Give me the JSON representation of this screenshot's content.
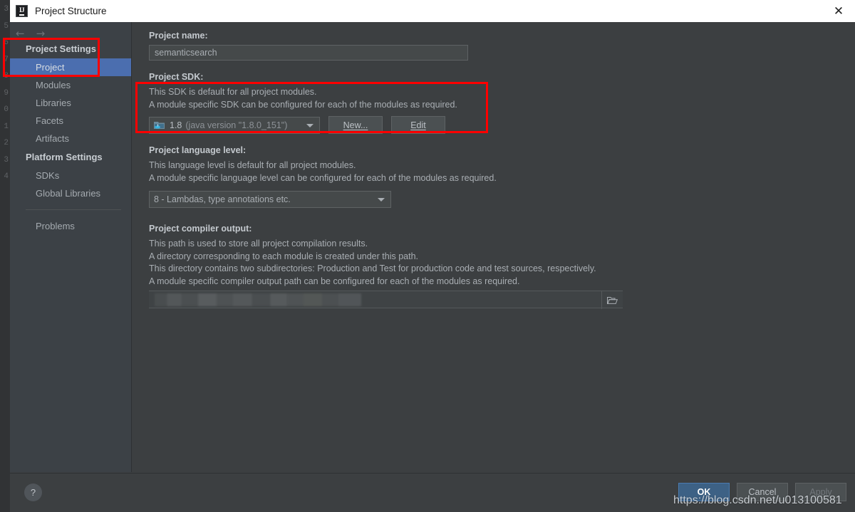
{
  "window": {
    "title": "Project Structure",
    "logo_icon": "intellij-idea-logo",
    "close_icon": "close-icon"
  },
  "editor_gutter": {
    "line_numbers": [
      "3",
      "5",
      "6",
      "7",
      "8",
      "9",
      "0",
      "1",
      "2",
      "3",
      "4"
    ]
  },
  "sidebar": {
    "back_icon": "arrow-left-icon",
    "forward_icon": "arrow-right-icon",
    "groups": [
      {
        "label": "Project Settings",
        "items": [
          {
            "label": "Project",
            "selected": true
          },
          {
            "label": "Modules",
            "selected": false
          },
          {
            "label": "Libraries",
            "selected": false
          },
          {
            "label": "Facets",
            "selected": false
          },
          {
            "label": "Artifacts",
            "selected": false
          }
        ]
      },
      {
        "label": "Platform Settings",
        "items": [
          {
            "label": "SDKs",
            "selected": false
          },
          {
            "label": "Global Libraries",
            "selected": false
          }
        ]
      }
    ],
    "problems_label": "Problems"
  },
  "main": {
    "project_name": {
      "label": "Project name:",
      "value": "semanticsearch"
    },
    "project_sdk": {
      "label": "Project SDK:",
      "description_line1": "This SDK is default for all project modules.",
      "description_line2": "A module specific SDK can be configured for each of the modules as required.",
      "selected_version": "1.8",
      "selected_detail": "(java version \"1.8.0_151\")",
      "sdk_icon": "java-sdk-folder-icon",
      "dropdown_icon": "chevron-down-icon",
      "new_button": "New...",
      "edit_button": "Edit"
    },
    "language_level": {
      "label": "Project language level:",
      "description_line1": "This language level is default for all project modules.",
      "description_line2": "A module specific language level can be configured for each of the modules as required.",
      "selected": "8 - Lambdas, type annotations etc.",
      "dropdown_icon": "chevron-down-icon"
    },
    "compiler_output": {
      "label": "Project compiler output:",
      "description_line1": "This path is used to store all project compilation results.",
      "description_line2": "A directory corresponding to each module is created under this path.",
      "description_line3": "This directory contains two subdirectories: Production and Test for production code and test sources, respectively.",
      "description_line4": "A module specific compiler output path can be configured for each of the modules as required.",
      "value": "",
      "browse_icon": "folder-open-icon"
    }
  },
  "footer": {
    "help_icon": "question-mark-icon",
    "ok_label": "OK",
    "cancel_label": "Cancel",
    "apply_label": "Apply"
  },
  "annotations": {
    "highlight_color": "#ff0000",
    "watermark_text": "https://blog.csdn.net/u013100581"
  },
  "colors": {
    "selection_blue": "#4b6eaf",
    "dialog_bg": "#3c3f41",
    "sidebar_bg": "#3c4146",
    "titlebar_bg": "#ffffff",
    "primary_button": "#3d6185"
  }
}
